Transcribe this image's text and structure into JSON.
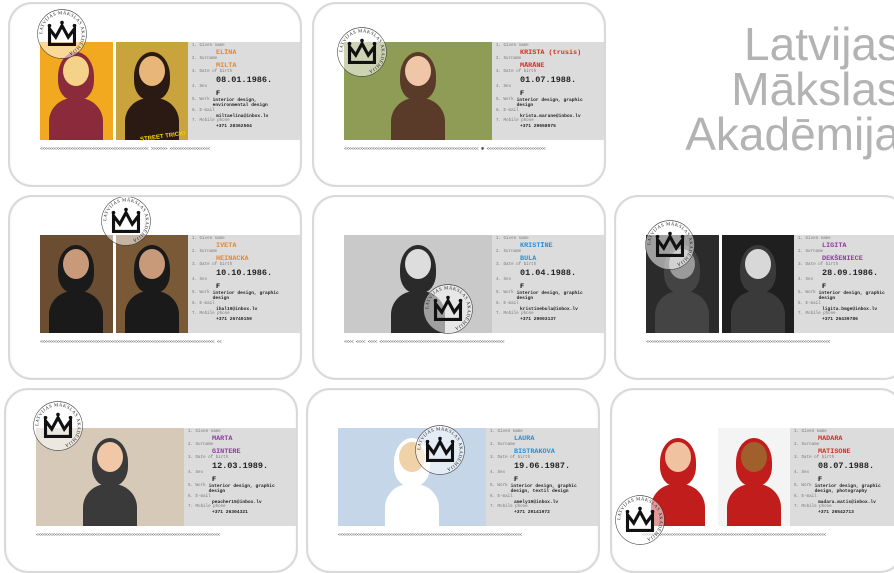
{
  "brand": {
    "line1": "Latvijas",
    "line2": "Mākslas",
    "line3": "Akadēmija"
  },
  "seal_text": "LATVIJAS MĀKSLAS AKADĒMIJA",
  "field_labels": {
    "given": "1. Given name",
    "surname": "2. Surname",
    "dob": "3. Date of birth",
    "sex": "4. Sex",
    "work": "5. Work",
    "email": "6. E-mail",
    "phone": "7. Mobile phone"
  },
  "cards": [
    {
      "given": "ELĪNA",
      "surname": "MILTA",
      "dob": "08.01.1986.",
      "sex": "F",
      "work": "interior design, environmental design",
      "email": "miltaelina@inbox.lv",
      "phone": "+371 28362504",
      "mrz": "<<<<<<<<<<<<<<<<<<<<<<<<<<<<<<<<<<<<<<<<<<<<<< >>>>>>>    <<<<<<<<<<<<<<<<<",
      "given_color": "#e8862a",
      "surname_color": "#e8862a",
      "photo_caption": "STREET TRICK!"
    },
    {
      "given": "KRISTA (trusis)",
      "surname": "MĀRĀNE",
      "dob": "01.07.1988.",
      "sex": "F",
      "work": "interior design, graphic design",
      "email": "krista.marane@inbox.lv",
      "phone": "+371 29658075",
      "mrz": "<<<<<<<<<<<<<<<<<<<<<<<<<<<<<<<<<<<<<<<<<<<<<<<<<<<<<<<<< ✱ <<<<<<<<<<<<<<<<<<<<<<<<<",
      "given_color": "#d6301c",
      "surname_color": "#d6301c"
    },
    {
      "given": "IVETA",
      "surname": "HEINACKA",
      "dob": "10.10.1986.",
      "sex": "F",
      "work": "interior design, graphic design",
      "email": "ihal10@inbox.lv",
      "phone": "+371 26740159",
      "mrz": "<<<<<<<<<<<<<<<<<<<<<<<<<<<<<<<<<<<<<<<<<<<<<<<<<<<<<<<<<<<<<<<<<<<<<<<<<<       <<",
      "given_color": "#e8862a",
      "surname_color": "#e8862a"
    },
    {
      "given": "KRISTĪNE",
      "surname": "BULA",
      "dob": "01.04.1988.",
      "sex": "F",
      "work": "interior design, graphic design",
      "email": "kristinebula@inbox.lv",
      "phone": "+371 29003137",
      "mrz": "<<<< <<<< <<<< <<<<<<<<<<<<<<<<<<<<<<<<<<<<<<<<<<<<<<<<<<<<<<<<<<<<<",
      "given_color": "#2a8fd6",
      "surname_color": "#2a8fd6"
    },
    {
      "given": "LIGITA",
      "surname": "DEKŠENIECE",
      "dob": "28.09.1986.",
      "sex": "F",
      "work": "interior design, graphic design",
      "email": "ligita.bmge@inbox.lv",
      "phone": "+371 26439786",
      "mrz": "<<<<<<<<<<<<<<<<<<<<<<<<<<<<<<<<<<<<<<<<<<<<<<<<<<<<<<<<<<<<<<<<<<<<<<<<<<<<<<",
      "given_color": "#8d3ca0",
      "surname_color": "#8d3ca0"
    },
    {
      "given": "MARTA",
      "surname": "GINTERE",
      "dob": "12.03.1989.",
      "sex": "F",
      "work": "interior design, graphic design",
      "email": "peacher15@inbox.lv",
      "phone": "+371 26304321",
      "mrz": "<<<<<<<<<<<<<<<<<<<<<<<<<<<<<<<<<<<<<<<<<<<<<<<<<<<<<<<<<<<<<<<<<<<<<<<<<<<<<<",
      "given_color": "#8d3ca0",
      "surname_color": "#8d3ca0"
    },
    {
      "given": "LAURA",
      "surname": "BISTRAKOVA",
      "dob": "19.06.1987.",
      "sex": "F",
      "work": "interior design, graphic design, textil design",
      "email": "amely19@inbox.lv",
      "phone": "+371 29141972",
      "mrz": "<<<<<<<<<<<<<<<<<<<<<<<<<<<<<<<<<<<<<<<<<<<<<<<<<<<<<<<<<<<<<<<<<<<<<<<<<<<<<<",
      "given_color": "#2a8fd6",
      "surname_color": "#2a8fd6"
    },
    {
      "given": "MADARA",
      "surname": "MATISONE",
      "dob": "08.07.1988.",
      "sex": "F",
      "work": "interior design, graphic design, photography",
      "email": "madara.matis@inbox.lv",
      "phone": "+371 26542713",
      "mrz": "<<<<<<<<<<<<<<<<<<<<<<<<<<<<<<<<<<<<<<<<<<<<<<<<<<<<<<<<<<<<<<<<<<<<<<<<<<<<<<",
      "given_color": "#d6301c",
      "surname_color": "#d6301c"
    }
  ]
}
